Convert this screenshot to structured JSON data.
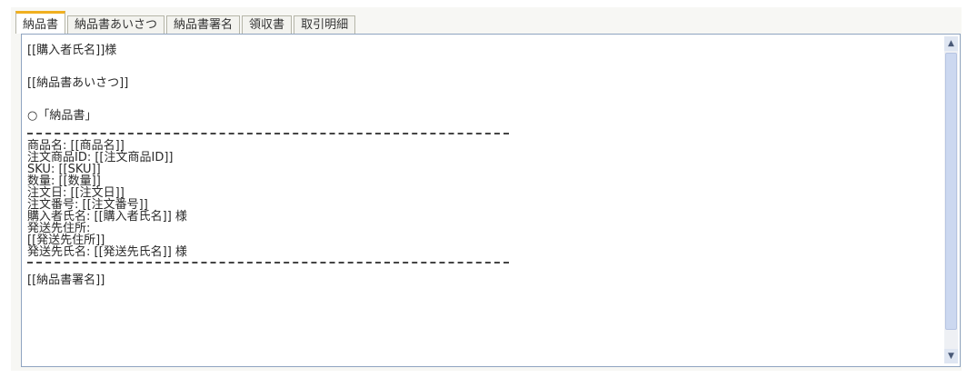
{
  "tabs": [
    {
      "label": "納品書"
    },
    {
      "label": "納品書あいさつ"
    },
    {
      "label": "納品書署名"
    },
    {
      "label": "領収書"
    },
    {
      "label": "取引明細"
    }
  ],
  "active_tab": 0,
  "editor": {
    "line_1": "[[購入者氏名]]様",
    "line_2": "[[納品書あいさつ]]",
    "line_3": "○「納品書」",
    "line_4": "商品名: [[商品名]]",
    "line_5": "注文商品ID: [[注文商品ID]]",
    "line_6": "SKU: [[SKU]]",
    "line_7": "数量: [[数量]]",
    "line_8": "注文日: [[注文日]]",
    "line_9": "注文番号: [[注文番号]]",
    "line_10": "購入者氏名: [[購入者氏名]] 様",
    "line_11": "発送先住所:",
    "line_12": "[[発送先住所]]",
    "line_13": "発送先氏名: [[発送先氏名]] 様",
    "line_14": "[[納品書署名]]"
  },
  "scrollbar": {
    "up_icon": "▲",
    "down_icon": "▼"
  }
}
